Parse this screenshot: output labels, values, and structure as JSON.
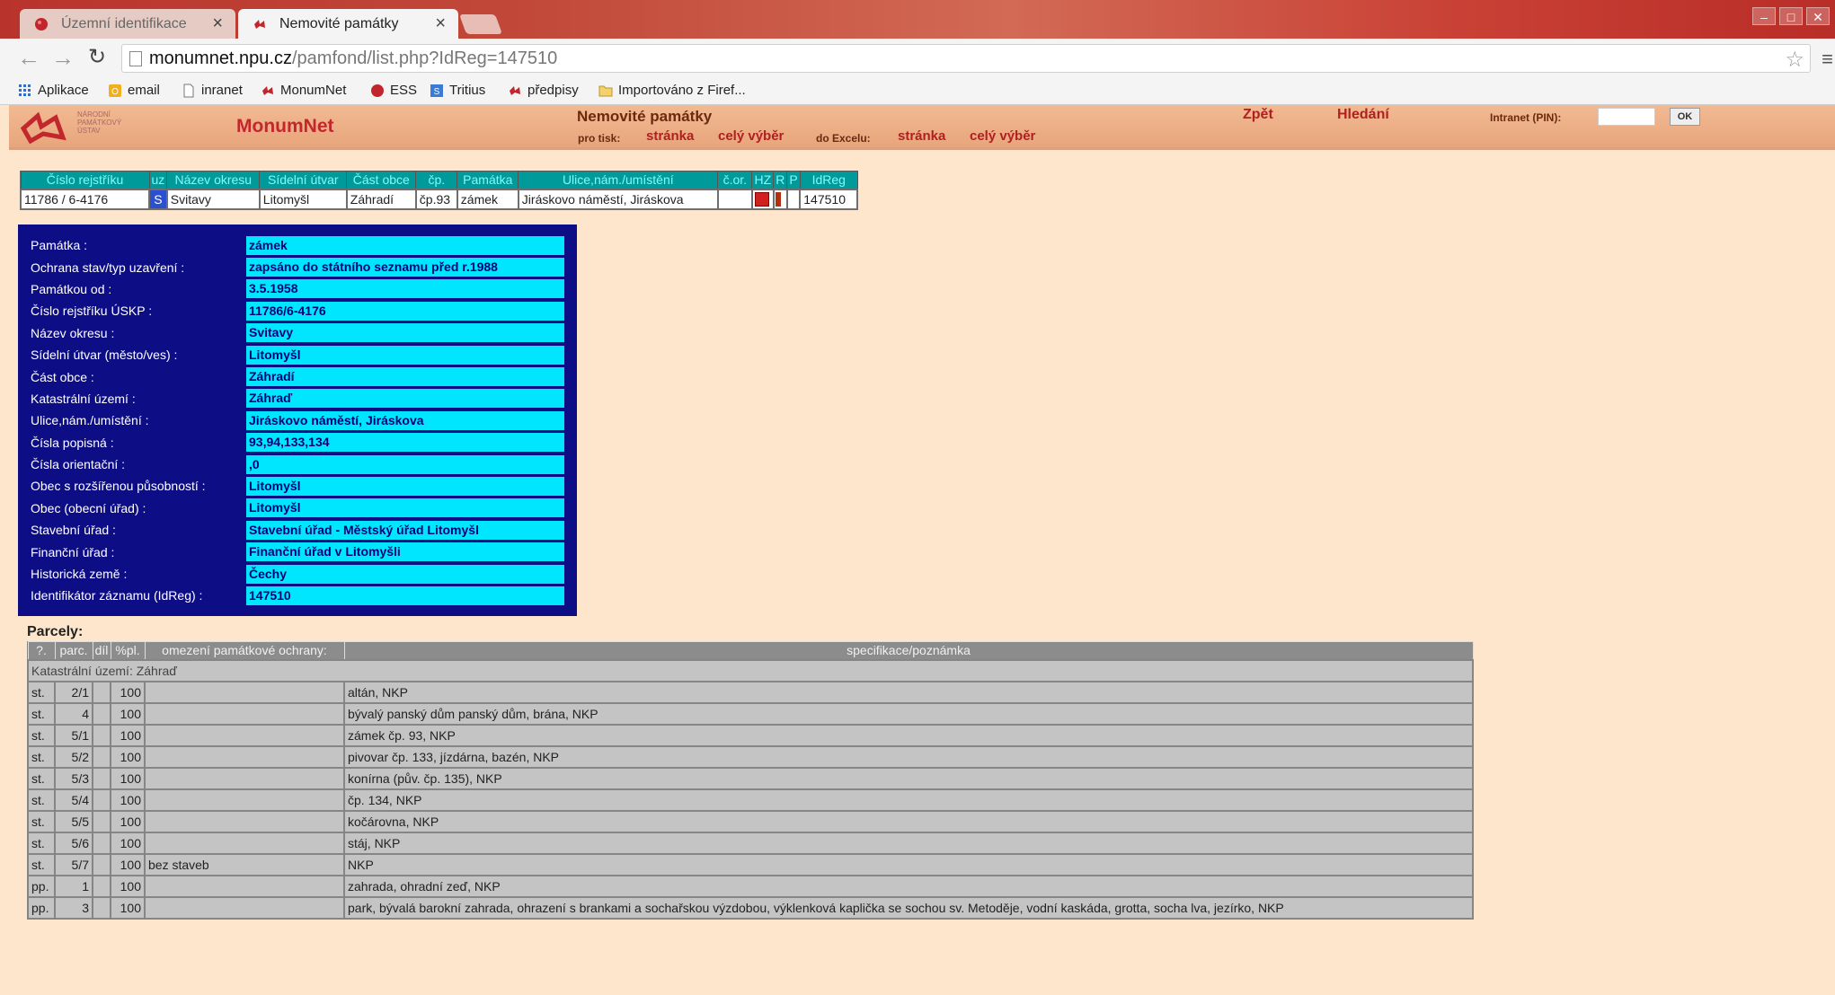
{
  "browser": {
    "tabs": [
      {
        "title": "Územní identifikace",
        "close": "×"
      },
      {
        "title": "Nemovité památky",
        "close": "×"
      }
    ],
    "url_host": "monumnet.npu.cz",
    "url_path": "/pamfond/list.php?IdReg=147510",
    "bookmarks": [
      "Aplikace",
      "email",
      "inranet",
      "MonumNet",
      "ESS",
      "Tritius",
      "předpisy",
      "Importováno z Firef..."
    ]
  },
  "header": {
    "logo_text": "NÁRODNÍ PAMÁTKOVÝ ÚSTAV",
    "app_title": "MonumNet",
    "page_heading": "Nemovité památky",
    "print_label": "pro tisk:",
    "print_page": "stránka",
    "print_all": "celý výběr",
    "excel_label": "do Excelu:",
    "excel_page": "stránka",
    "excel_all": "celý výběr",
    "back": "Zpět",
    "search": "Hledání",
    "intranet_label": "Intranet (PIN):",
    "ok": "OK"
  },
  "summary": {
    "columns": [
      "Číslo rejstříku",
      "uz",
      "Název okresu",
      "Sídelní útvar",
      "Část obce",
      "čp.",
      "Památka",
      "Ulice,nám./umístění",
      "č.or.",
      "HZ",
      "R",
      "P",
      "IdReg"
    ],
    "row": {
      "rejstrik": "11786 / 6-4176",
      "uz": "S",
      "okres": "Svitavy",
      "utvar": "Litomyšl",
      "cast": "Záhradí",
      "cp": "čp.93",
      "pamatka": "zámek",
      "ulice": "Jiráskovo náměstí, Jiráskova",
      "cor": "",
      "idreg": "147510"
    },
    "colors": {
      "header_bg": "#009a9a",
      "header_text": "#7ffafa"
    }
  },
  "detail": [
    {
      "label": "Památka :",
      "value": "zámek"
    },
    {
      "label": "Ochrana stav/typ uzavření :",
      "value": "zapsáno do státního seznamu před r.1988"
    },
    {
      "label": "Památkou od :",
      "value": "3.5.1958"
    },
    {
      "label": "Číslo rejstříku ÚSKP :",
      "value": "11786/6-4176"
    },
    {
      "label": "Název okresu :",
      "value": "Svitavy"
    },
    {
      "label": "Sídelní útvar (město/ves) :",
      "value": "Litomyšl"
    },
    {
      "label": "Část obce :",
      "value": "Záhradí"
    },
    {
      "label": "Katastrální území :",
      "value": "Záhraď"
    },
    {
      "label": "Ulice,nám./umístění :",
      "value": "Jiráskovo náměstí, Jiráskova"
    },
    {
      "label": "Čísla popisná :",
      "value": "93,94,133,134"
    },
    {
      "label": "Čísla orientační :",
      "value": ",0"
    },
    {
      "label": "Obec s rozšířenou působností :",
      "value": "Litomyšl"
    },
    {
      "label": "Obec (obecní úřad) :",
      "value": "Litomyšl"
    },
    {
      "label": "Stavební úřad :",
      "value": "Stavební úřad - Městský úřad Litomyšl"
    },
    {
      "label": "Finanční úřad :",
      "value": "Finanční úřad v Litomyšli"
    },
    {
      "label": "Historická země :",
      "value": "Čechy"
    },
    {
      "label": "Identifikátor záznamu (IdReg) :",
      "value": "147510"
    }
  ],
  "parcely": {
    "title": "Parcely:",
    "columns": [
      "?.",
      "parc.",
      "díl",
      "%pl.",
      "omezení památkové ochrany:",
      "specifikace/poznámka"
    ],
    "ku_row": "Katastrální území: Záhraď",
    "rows": [
      {
        "type": "st.",
        "parc": "2/1",
        "dil": "",
        "pl": "100",
        "omezeni": "",
        "spec": "altán, NKP"
      },
      {
        "type": "st.",
        "parc": "4",
        "dil": "",
        "pl": "100",
        "omezeni": "",
        "spec": "bývalý panský dům panský dům, brána, NKP"
      },
      {
        "type": "st.",
        "parc": "5/1",
        "dil": "",
        "pl": "100",
        "omezeni": "",
        "spec": "zámek čp. 93, NKP"
      },
      {
        "type": "st.",
        "parc": "5/2",
        "dil": "",
        "pl": "100",
        "omezeni": "",
        "spec": "pivovar čp. 133, jízdárna, bazén, NKP"
      },
      {
        "type": "st.",
        "parc": "5/3",
        "dil": "",
        "pl": "100",
        "omezeni": "",
        "spec": "konírna (pův. čp. 135), NKP"
      },
      {
        "type": "st.",
        "parc": "5/4",
        "dil": "",
        "pl": "100",
        "omezeni": "",
        "spec": "čp. 134, NKP"
      },
      {
        "type": "st.",
        "parc": "5/5",
        "dil": "",
        "pl": "100",
        "omezeni": "",
        "spec": "kočárovna, NKP"
      },
      {
        "type": "st.",
        "parc": "5/6",
        "dil": "",
        "pl": "100",
        "omezeni": "",
        "spec": "stáj, NKP"
      },
      {
        "type": "st.",
        "parc": "5/7",
        "dil": "",
        "pl": "100",
        "omezeni": "bez staveb",
        "spec": "NKP"
      },
      {
        "type": "pp.",
        "parc": "1",
        "dil": "",
        "pl": "100",
        "omezeni": "",
        "spec": "zahrada, ohradní zeď, NKP"
      },
      {
        "type": "pp.",
        "parc": "3",
        "dil": "",
        "pl": "100",
        "omezeni": "",
        "spec": "park, bývalá barokní zahrada, ohrazení s brankami a sochařskou výzdobou, výklenková kaplička se sochou sv. Metoděje, vodní kaskáda, grotta, socha lva, jezírko, NKP"
      }
    ]
  }
}
